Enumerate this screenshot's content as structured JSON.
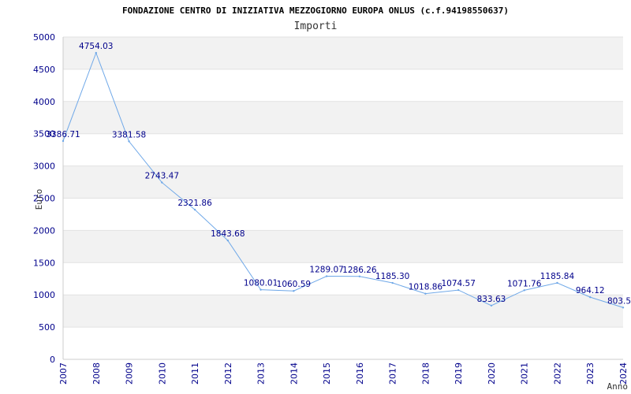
{
  "chart_data": {
    "type": "line",
    "title": "FONDAZIONE CENTRO DI INIZIATIVA MEZZOGIORNO EUROPA ONLUS (c.f.94198550637)",
    "subtitle": "Importi",
    "xlabel": "Anno",
    "ylabel": "Euro",
    "ylim": [
      0,
      5000
    ],
    "yticks": [
      0,
      500,
      1000,
      1500,
      2000,
      2500,
      3000,
      3500,
      4000,
      4500,
      5000
    ],
    "grid": true,
    "series": [
      {
        "color": "#6fa8e8",
        "points": [
          {
            "x": "2007",
            "y": 3386.71,
            "label": "3386.71"
          },
          {
            "x": "2008",
            "y": 4754.03,
            "label": "4754.03"
          },
          {
            "x": "2009",
            "y": 3381.58,
            "label": "3381.58"
          },
          {
            "x": "2010",
            "y": 2743.47,
            "label": "2743.47"
          },
          {
            "x": "2011",
            "y": 2321.86,
            "label": "2321.86"
          },
          {
            "x": "2012",
            "y": 1843.68,
            "label": "1843.68"
          },
          {
            "x": "2013",
            "y": 1080.01,
            "label": "1080.01"
          },
          {
            "x": "2014",
            "y": 1060.59,
            "label": "1060.59"
          },
          {
            "x": "2015",
            "y": 1289.07,
            "label": "1289.07"
          },
          {
            "x": "2016",
            "y": 1286.26,
            "label": "1286.26"
          },
          {
            "x": "2017",
            "y": 1185.3,
            "label": "1185.30"
          },
          {
            "x": "2018",
            "y": 1018.86,
            "label": "1018.86"
          },
          {
            "x": "2019",
            "y": 1074.57,
            "label": "1074.57"
          },
          {
            "x": "2020",
            "y": 833.63,
            "label": "833.63"
          },
          {
            "x": "2021",
            "y": 1071.76,
            "label": "1071.76"
          },
          {
            "x": "2022",
            "y": 1185.84,
            "label": "1185.84"
          },
          {
            "x": "2023",
            "y": 964.12,
            "label": "964.12"
          },
          {
            "x": "2024",
            "y": 803.5,
            "label": "803.5"
          }
        ]
      }
    ]
  },
  "colors": {
    "band": "#f2f2f2",
    "gridline": "#e2e2e2",
    "axis": "#cccccc",
    "line": "#6fa8e8",
    "ticktext": "#00008b"
  }
}
